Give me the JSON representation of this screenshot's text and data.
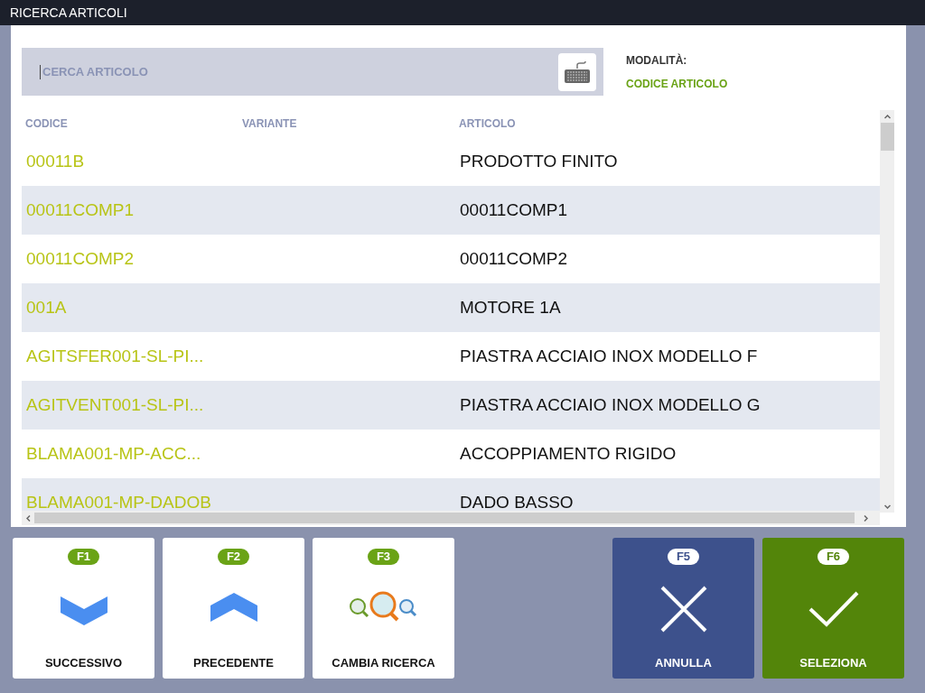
{
  "window": {
    "title": "RICERCA ARTICOLI"
  },
  "search": {
    "placeholder": "CERCA ARTICOLO"
  },
  "mode": {
    "label": "MODALITÀ:",
    "value": "CODICE ARTICOLO"
  },
  "table": {
    "columns": [
      "CODICE",
      "VARIANTE",
      "ARTICOLO"
    ],
    "rows": [
      {
        "codice": "00011B",
        "articolo": "PRODOTTO FINITO"
      },
      {
        "codice": "00011COMP1",
        "articolo": "00011COMP1"
      },
      {
        "codice": "00011COMP2",
        "articolo": "00011COMP2"
      },
      {
        "codice": "001A",
        "articolo": "MOTORE 1A"
      },
      {
        "codice": "AGITSFER001-SL-PI...",
        "articolo": "PIASTRA ACCIAIO INOX MODELLO F"
      },
      {
        "codice": "AGITVENT001-SL-PI...",
        "articolo": "PIASTRA ACCIAIO INOX MODELLO G"
      },
      {
        "codice": "BLAMA001-MP-ACC...",
        "articolo": "ACCOPPIAMENTO RIGIDO"
      },
      {
        "codice": "BLAMA001-MP-DADOB",
        "articolo": "DADO BASSO"
      }
    ]
  },
  "buttons": [
    {
      "kind": "down",
      "key": "F1",
      "label": "SUCCESSIVO"
    },
    {
      "kind": "up",
      "key": "F2",
      "label": "PRECEDENTE"
    },
    {
      "kind": "search",
      "key": "F3",
      "label": "CAMBIA RICERCA"
    },
    {
      "kind": "cancel",
      "key": "F5",
      "label": "ANNULLA"
    },
    {
      "kind": "select",
      "key": "F6",
      "label": "SELEZIONA"
    }
  ]
}
